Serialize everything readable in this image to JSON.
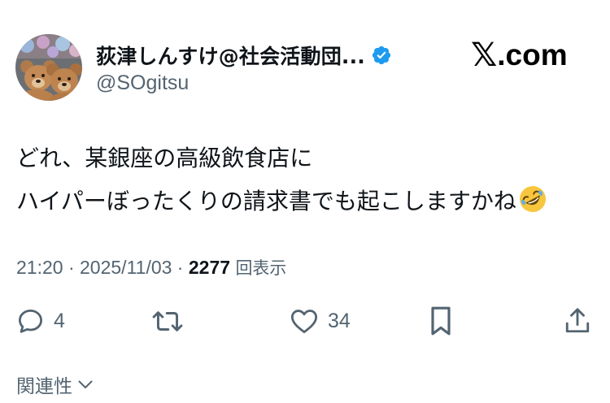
{
  "author": {
    "display_name": "荻津しんすけ@社会活動団...",
    "handle": "@SOgitsu",
    "avatar_icon": "teddy-bears-avatar",
    "verified_icon": "verified-badge-icon",
    "verified_color": "#1d9bf0"
  },
  "brand": {
    "logo_text": "𝕏",
    "domain_text": ".com"
  },
  "tweet": {
    "lines": [
      "どれ、某銀座の高級飲食店に",
      "ハイパーぼったくりの請求書でも起こしますかね"
    ],
    "emoji_icon": "rolling-on-floor-laughing-emoji"
  },
  "meta": {
    "time": "21:20",
    "separator": " · ",
    "date": "2025/11/03",
    "views_count": "2277",
    "views_label": "回表示"
  },
  "actions": {
    "reply_count": "4",
    "retweet_count": "",
    "like_count": "34"
  },
  "related": {
    "label": "関連性"
  },
  "colors": {
    "text_primary": "#0f1419",
    "text_secondary": "#536471",
    "background": "#ffffff"
  }
}
